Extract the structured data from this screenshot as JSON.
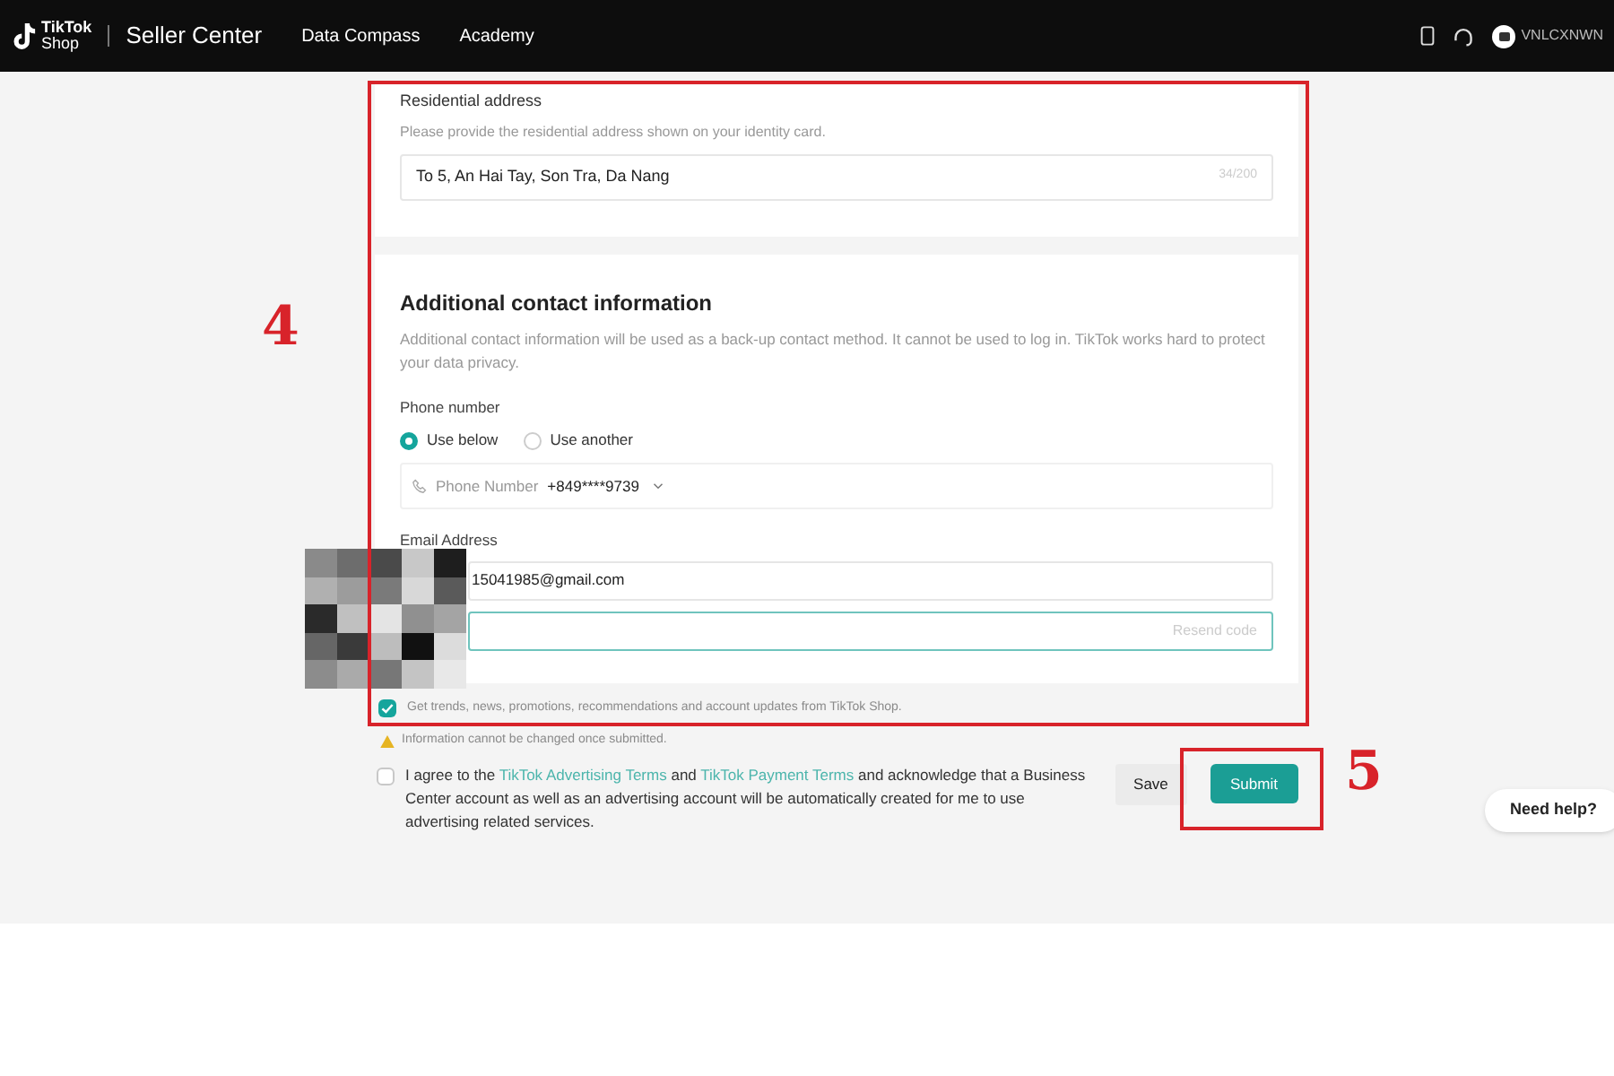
{
  "topbar": {
    "logo_line1": "TikTok",
    "logo_line2": "Shop",
    "title": "Seller Center",
    "nav": [
      {
        "label": "Data Compass"
      },
      {
        "label": "Academy"
      }
    ],
    "account": "VNLCXNWN"
  },
  "residential": {
    "label": "Residential address",
    "hint": "Please provide the residential address shown on your identity card.",
    "value": "To 5, An Hai Tay, Son Tra, Da Nang",
    "counter": "34/200"
  },
  "contact": {
    "heading": "Additional contact information",
    "description": "Additional contact information will be used as a back-up contact method. It cannot be used to log in. TikTok works hard to protect your data privacy.",
    "phone_label": "Phone number",
    "phone_options": [
      {
        "label": "Use below",
        "selected": true
      },
      {
        "label": "Use another",
        "selected": false
      }
    ],
    "phone_field_label": "Phone Number",
    "phone_value": "+849****9739",
    "email_label": "Email Address",
    "email_value": "15041985@gmail.com",
    "resend": "Resend code"
  },
  "updates": {
    "checked": true,
    "label": "Get trends, news, promotions, recommendations and account updates from TikTok Shop."
  },
  "warning": "Information cannot be changed once submitted.",
  "agree": {
    "checked": false,
    "text_before": "I agree to the",
    "link1": "TikTok Advertising Terms",
    "text_mid": "and",
    "link2": "TikTok Payment Terms",
    "text_after": "and acknowledge that a Business Center account as well as an advertising account will be automatically created for me to use advertising related services."
  },
  "buttons": {
    "save": "Save",
    "submit": "Submit"
  },
  "annotations": [
    {
      "number": "4"
    },
    {
      "number": "5"
    }
  ],
  "help": "Need help?"
}
